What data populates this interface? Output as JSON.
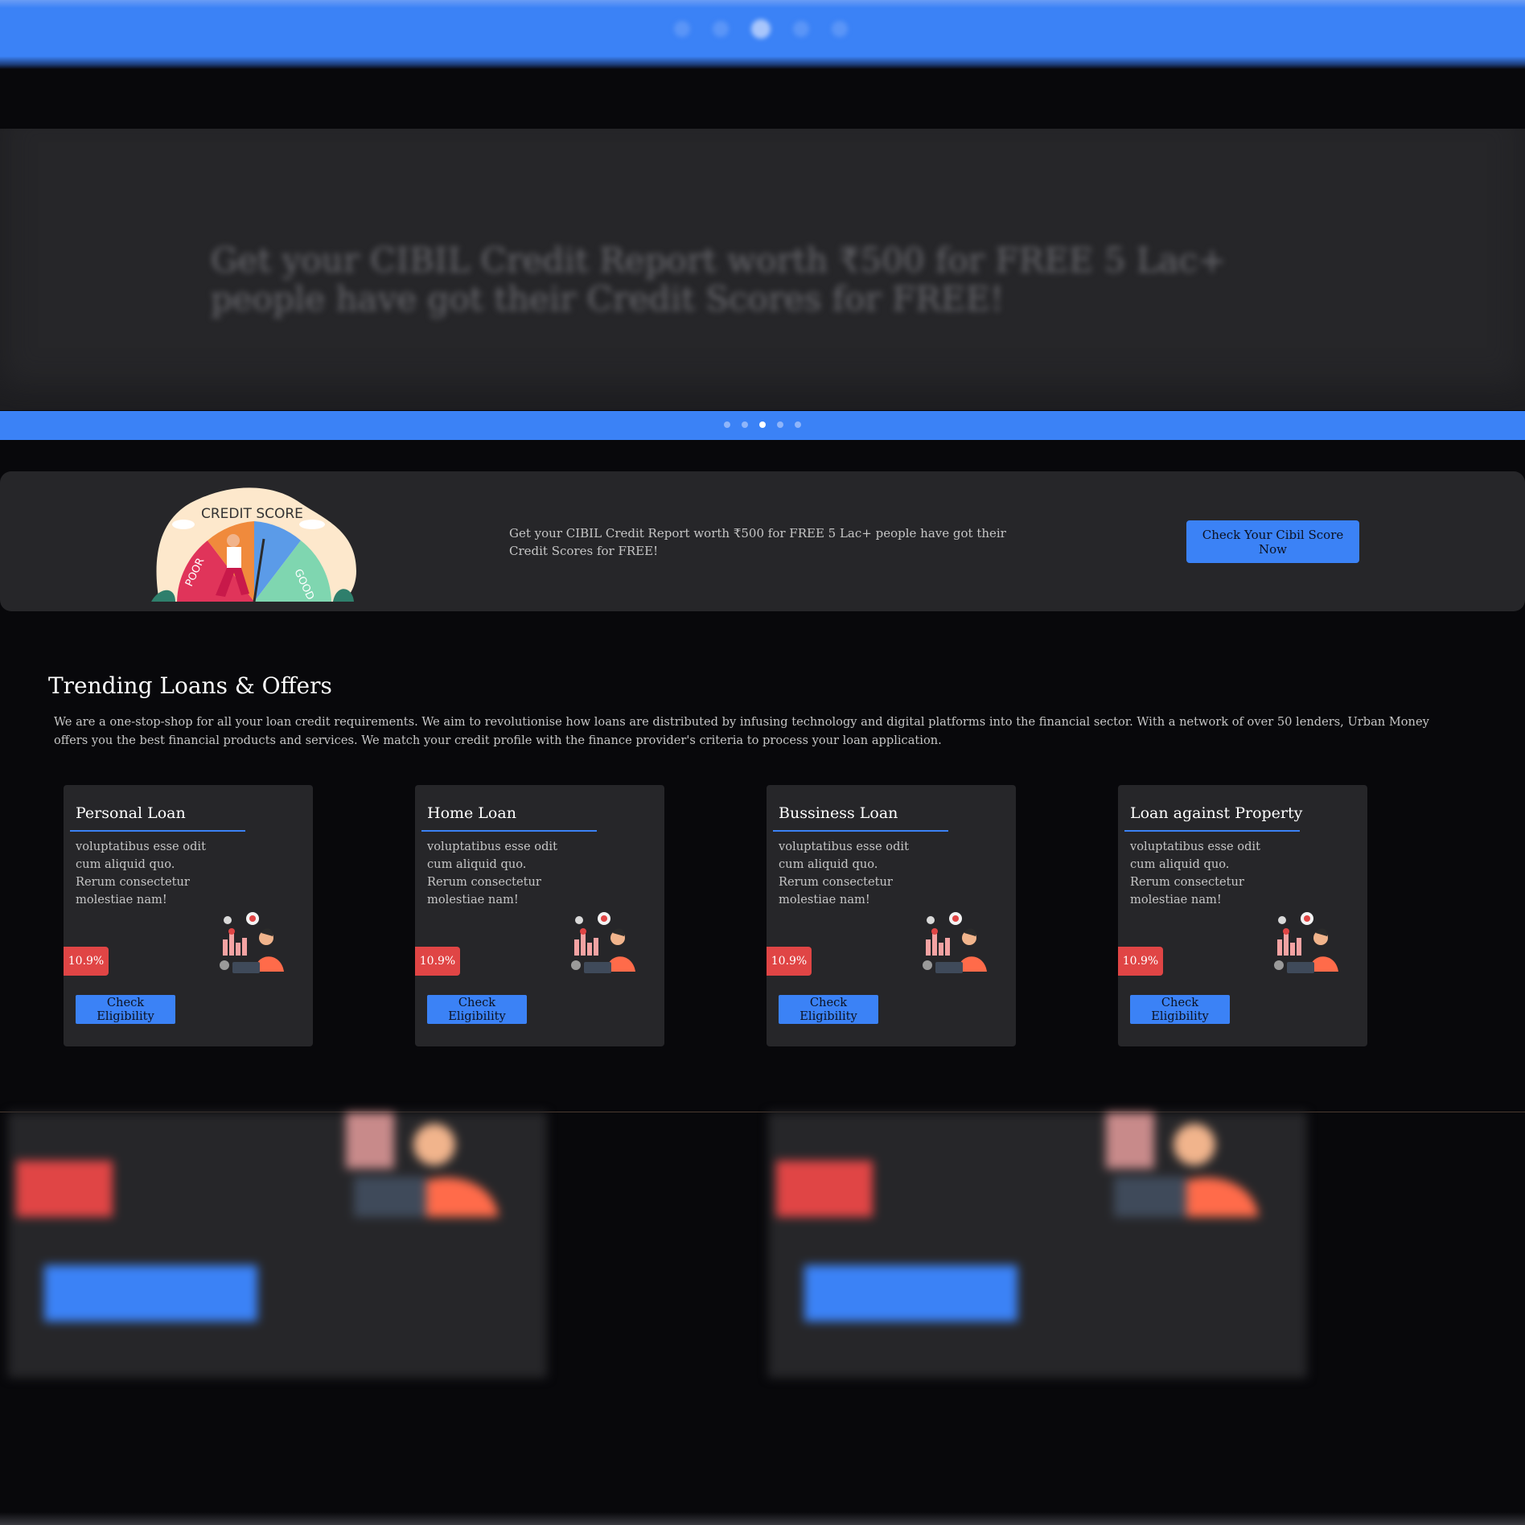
{
  "hero": {
    "headline": "Get your CIBIL Credit Report worth ₹500 for FREE 5 Lac+ people have got their Credit Scores for FREE!",
    "slide_count": 5,
    "active_slide": 3
  },
  "cibil_banner": {
    "illustration": {
      "title": "CREDIT SCORE",
      "poor_label": "POOR",
      "good_label": "GOOD"
    },
    "text": "Get your CIBIL Credit Report worth ₹500 for FREE 5 Lac+ people have got their Credit Scores for FREE!",
    "button_label": "Check Your Cibil Score Now"
  },
  "trending": {
    "title": "Trending Loans & Offers",
    "description": "We are a one-stop-shop for all your loan credit requirements. We aim to revolutionise how loans are distributed by infusing technology and digital platforms into the financial sector. With a network of over 50 lenders, Urban Money offers you the best financial products and services. We match your credit profile with the finance provider's criteria to process your loan application.",
    "cards": [
      {
        "title": "Personal Loan",
        "description": "voluptatibus esse odit cum aliquid quo. Rerum consectetur molestiae nam!",
        "rate": "10.9%",
        "button_label": "Check Eligibility"
      },
      {
        "title": "Home Loan",
        "description": "voluptatibus esse odit cum aliquid quo. Rerum consectetur molestiae nam!",
        "rate": "10.9%",
        "button_label": "Check Eligibility"
      },
      {
        "title": "Bussiness Loan",
        "description": "voluptatibus esse odit cum aliquid quo. Rerum consectetur molestiae nam!",
        "rate": "10.9%",
        "button_label": "Check Eligibility"
      },
      {
        "title": "Loan against Property",
        "description": "voluptatibus esse odit cum aliquid quo. Rerum consectetur molestiae nam!",
        "rate": "10.9%",
        "button_label": "Check Eligibility"
      }
    ]
  },
  "colors": {
    "accent": "#3b82f6",
    "badge": "#e04545",
    "card_bg": "#262629",
    "page_bg": "#08080b"
  }
}
